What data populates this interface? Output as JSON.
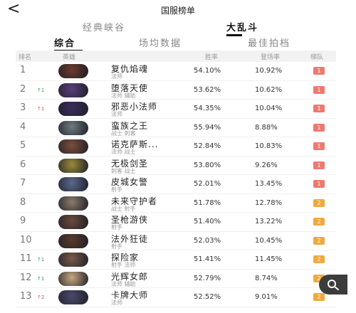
{
  "nav": {
    "back_icon": "chevron-left-icon",
    "title": "国服榜单"
  },
  "mode_tabs": [
    {
      "label": "经典峡谷"
    },
    {
      "label": "大乱斗"
    }
  ],
  "sub_tabs": [
    {
      "label": "综合"
    },
    {
      "label": "场均数据"
    },
    {
      "label": "最佳拍档"
    }
  ],
  "table_header": {
    "rank": "排名",
    "hero": "英雄",
    "win": "胜率",
    "pick": "登场率",
    "tier": "梯队"
  },
  "rows": [
    {
      "rank": "1",
      "trend": "",
      "trend_dir": "",
      "name": "复仇焰魂",
      "roles": "法师",
      "win": "54.10%",
      "pick": "10.92%",
      "tier": "1",
      "avatar_color": "#6b3a2a"
    },
    {
      "rank": "2",
      "trend": "↑1",
      "trend_dir": "up",
      "name": "堕落天使",
      "roles": "法师  辅助",
      "win": "53.62%",
      "pick": "10.62%",
      "tier": "1",
      "avatar_color": "#5a3f7a"
    },
    {
      "rank": "3",
      "trend": "↑1",
      "trend_dir": "down",
      "name": "邪恶小法师",
      "roles": "法师",
      "win": "54.35%",
      "pick": "10.04%",
      "tier": "1",
      "avatar_color": "#3b2f5c"
    },
    {
      "rank": "4",
      "trend": "",
      "trend_dir": "",
      "name": "蛮族之王",
      "roles": "战士  刺客",
      "win": "55.94%",
      "pick": "8.88%",
      "tier": "1",
      "avatar_color": "#6e7a80"
    },
    {
      "rank": "5",
      "trend": "",
      "trend_dir": "",
      "name": "诺克萨斯...",
      "roles": "法师  战士",
      "win": "52.84%",
      "pick": "10.83%",
      "tier": "1",
      "avatar_color": "#7a4e3a"
    },
    {
      "rank": "6",
      "trend": "",
      "trend_dir": "",
      "name": "无极剑圣",
      "roles": "刺客  战士",
      "win": "53.80%",
      "pick": "9.26%",
      "tier": "1",
      "avatar_color": "#9a8a3a"
    },
    {
      "rank": "7",
      "trend": "",
      "trend_dir": "",
      "name": "皮城女警",
      "roles": "射手",
      "win": "52.01%",
      "pick": "13.45%",
      "tier": "1",
      "avatar_color": "#5a6a8a"
    },
    {
      "rank": "8",
      "trend": "",
      "trend_dir": "",
      "name": "未来守护者",
      "roles": "战士  射手",
      "win": "51.78%",
      "pick": "12.78%",
      "tier": "2",
      "avatar_color": "#8a7a6a"
    },
    {
      "rank": "9",
      "trend": "",
      "trend_dir": "",
      "name": "圣枪游侠",
      "roles": "射手",
      "win": "51.40%",
      "pick": "13.22%",
      "tier": "2",
      "avatar_color": "#6a4a3a"
    },
    {
      "rank": "10",
      "trend": "",
      "trend_dir": "",
      "name": "法外狂徒",
      "roles": "射手",
      "win": "52.03%",
      "pick": "10.45%",
      "tier": "2",
      "avatar_color": "#5a3a2a"
    },
    {
      "rank": "11",
      "trend": "↑1",
      "trend_dir": "up",
      "name": "探险家",
      "roles": "射手  法师",
      "win": "51.41%",
      "pick": "11.45%",
      "tier": "2",
      "avatar_color": "#7a5a4a"
    },
    {
      "rank": "12",
      "trend": "↑1",
      "trend_dir": "up",
      "name": "光辉女郎",
      "roles": "法师  辅助",
      "win": "52.79%",
      "pick": "8.74%",
      "tier": "2",
      "avatar_color": "#c8a880"
    },
    {
      "rank": "13",
      "trend": "↑2",
      "trend_dir": "down",
      "name": "卡牌大师",
      "roles": "法师",
      "win": "52.52%",
      "pick": "9.01%",
      "tier": "2",
      "avatar_color": "#4a4a6a"
    }
  ],
  "search_fab": {
    "icon": "search-icon"
  }
}
